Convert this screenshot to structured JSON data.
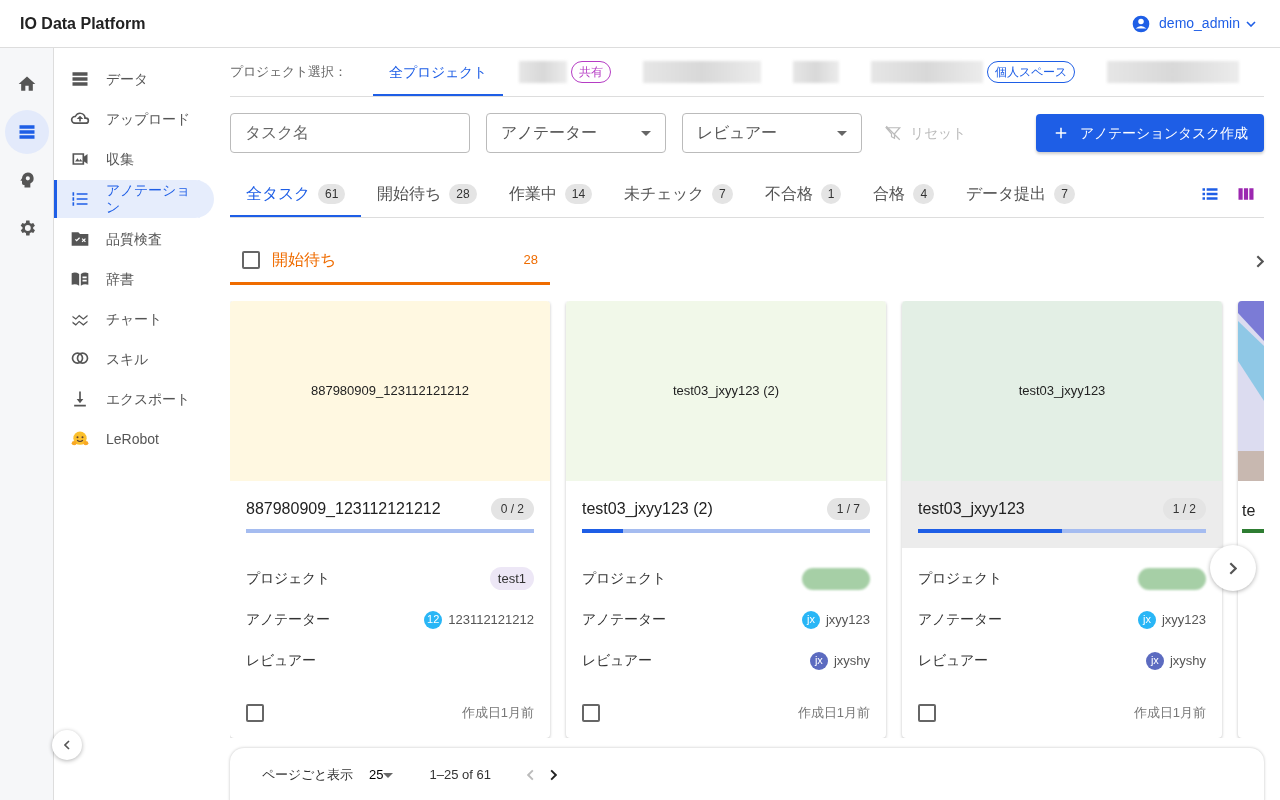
{
  "app": {
    "title": "IO Data Platform",
    "user": "demo_admin"
  },
  "rail": [
    {
      "selected": false
    },
    {
      "selected": true
    },
    {
      "selected": false
    },
    {
      "selected": false
    }
  ],
  "sidebar": {
    "items": [
      {
        "label": "データ",
        "selected": false
      },
      {
        "label": "アップロード",
        "selected": false
      },
      {
        "label": "収集",
        "selected": false
      },
      {
        "label": "アノテーション",
        "selected": true
      },
      {
        "label": "品質検査",
        "selected": false
      },
      {
        "label": "辞書",
        "selected": false
      },
      {
        "label": "チャート",
        "selected": false
      },
      {
        "label": "スキル",
        "selected": false
      },
      {
        "label": "エクスポート",
        "selected": false
      },
      {
        "label": "LeRobot",
        "selected": false
      }
    ]
  },
  "projects": {
    "label": "プロジェクト選択：",
    "tabs": [
      {
        "label": "全プロジェクト",
        "selected": true
      },
      {
        "blurred": true,
        "badge": {
          "label": "共有",
          "color": "#b53cc4"
        },
        "selected": false
      },
      {
        "blurred": true,
        "selected": false
      },
      {
        "blurred": true,
        "selected": false
      },
      {
        "blurred": true,
        "badge": {
          "label": "個人スペース",
          "color": "#1e5ee6"
        },
        "selected": false
      },
      {
        "blurred": true,
        "selected": false
      }
    ]
  },
  "filters": {
    "task_name": {
      "placeholder": "タスク名"
    },
    "annotator": {
      "placeholder": "アノテーター"
    },
    "reviewer": {
      "placeholder": "レビュアー"
    },
    "reset": {
      "label": "リセット",
      "disabled": true
    },
    "create": {
      "label": "アノテーションタスク作成"
    }
  },
  "status_tabs": [
    {
      "label": "全タスク",
      "count": "61",
      "selected": true
    },
    {
      "label": "開始待ち",
      "count": "28",
      "selected": false
    },
    {
      "label": "作業中",
      "count": "14",
      "selected": false
    },
    {
      "label": "未チェック",
      "count": "7",
      "selected": false
    },
    {
      "label": "不合格",
      "count": "1",
      "selected": false
    },
    {
      "label": "合格",
      "count": "4",
      "selected": false
    },
    {
      "label": "データ提出",
      "count": "7",
      "selected": false
    }
  ],
  "column": {
    "label": "開始待ち",
    "count": "28",
    "checked": false
  },
  "cards": [
    {
      "kind": "full",
      "preview": "887980909_123112121212",
      "color": "#fff8e1",
      "title": "887980909_123112121212",
      "progress": "0 / 2",
      "level": 0,
      "highlighted": false,
      "checked": false,
      "created": "作成日1月前",
      "fields": [
        {
          "label": "プロジェクト",
          "kind": "chip",
          "value": "test1"
        },
        {
          "label": "アノテーター",
          "kind": "user",
          "initials": "12",
          "value": "123112121212",
          "color": "#29b6f6"
        },
        {
          "label": "レビュアー",
          "kind": "empty"
        }
      ]
    },
    {
      "kind": "full",
      "preview": "test03_jxyy123 (2)",
      "color": "#f1f8e9",
      "title": "test03_jxyy123 (2)",
      "progress": "1 / 7",
      "level": 0.143,
      "highlighted": false,
      "checked": false,
      "created": "作成日1月前",
      "fields": [
        {
          "label": "プロジェクト",
          "kind": "blurred"
        },
        {
          "label": "アノテーター",
          "kind": "user",
          "initials": "jx",
          "value": "jxyy123",
          "color": "#29b6f6"
        },
        {
          "label": "レビュアー",
          "kind": "user",
          "initials": "jx",
          "value": "jxyshy",
          "color": "#5c6bc0"
        }
      ]
    },
    {
      "kind": "full",
      "preview": "test03_jxyy123",
      "color": "#e3efe5",
      "title": "test03_jxyy123",
      "progress": "1 / 2",
      "level": 0.5,
      "highlighted": true,
      "checked": false,
      "created": "作成日1月前",
      "fields": [
        {
          "label": "プロジェクト",
          "kind": "blurred"
        },
        {
          "label": "アノテーター",
          "kind": "user",
          "initials": "jx",
          "value": "jxyy123",
          "color": "#29b6f6"
        },
        {
          "label": "レビュアー",
          "kind": "user",
          "initials": "jx",
          "value": "jxyshy",
          "color": "#5c6bc0"
        }
      ]
    },
    {
      "kind": "stub",
      "title": "te",
      "color": "#2e7d32"
    }
  ],
  "pagination": {
    "label": "ページごと表示",
    "per_page": "25",
    "range": "1–25 of 61",
    "prev_disabled": true,
    "next_disabled": false
  }
}
